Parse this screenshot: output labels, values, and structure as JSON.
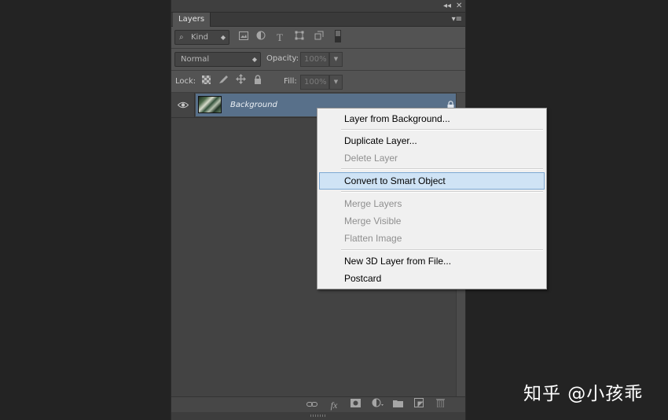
{
  "panel": {
    "collapse_glyph": "◂◂",
    "close_glyph": "✕",
    "tab_label": "Layers",
    "menu_glyph": "▾≡"
  },
  "filter_row": {
    "kind_label": "Kind",
    "search_glyph": "⌕",
    "icons": [
      "image-filter-icon",
      "adjustment-filter-icon",
      "type-filter-icon",
      "shape-filter-icon",
      "smart-object-filter-icon",
      "filter-toggle-icon"
    ]
  },
  "blend_row": {
    "blend_mode": "Normal",
    "opacity_label": "Opacity:",
    "opacity_value": "100%"
  },
  "lock_row": {
    "lock_label": "Lock:",
    "fill_label": "Fill:",
    "fill_value": "100%",
    "icons": [
      "lock-transparent-pixels-icon",
      "lock-image-pixels-icon",
      "lock-position-icon",
      "lock-all-icon"
    ]
  },
  "layers": [
    {
      "name": "Background",
      "visible": true,
      "locked": true,
      "selected": true
    }
  ],
  "bottom_bar": {
    "icons": [
      "link-layers-icon",
      "fx-icon",
      "add-mask-icon",
      "adjustment-layer-icon",
      "new-group-icon",
      "new-layer-icon",
      "trash-icon"
    ],
    "fx_label": "fx"
  },
  "context_menu": {
    "items": [
      {
        "label": "Layer from Background...",
        "enabled": true
      },
      {
        "label": "Duplicate Layer...",
        "enabled": true
      },
      {
        "label": "Delete Layer",
        "enabled": false
      },
      {
        "label": "Convert to Smart Object",
        "enabled": true,
        "highlighted": true
      },
      {
        "label": "Merge Layers",
        "enabled": false
      },
      {
        "label": "Merge Visible",
        "enabled": false
      },
      {
        "label": "Flatten Image",
        "enabled": false
      },
      {
        "label": "New 3D Layer from File...",
        "enabled": true
      },
      {
        "label": "Postcard",
        "enabled": true
      }
    ]
  },
  "watermark": "知乎 @小孩乖",
  "colors": {
    "panel_bg": "#535353",
    "selection": "#58708a",
    "menu_highlight": "#cfe3f5"
  }
}
